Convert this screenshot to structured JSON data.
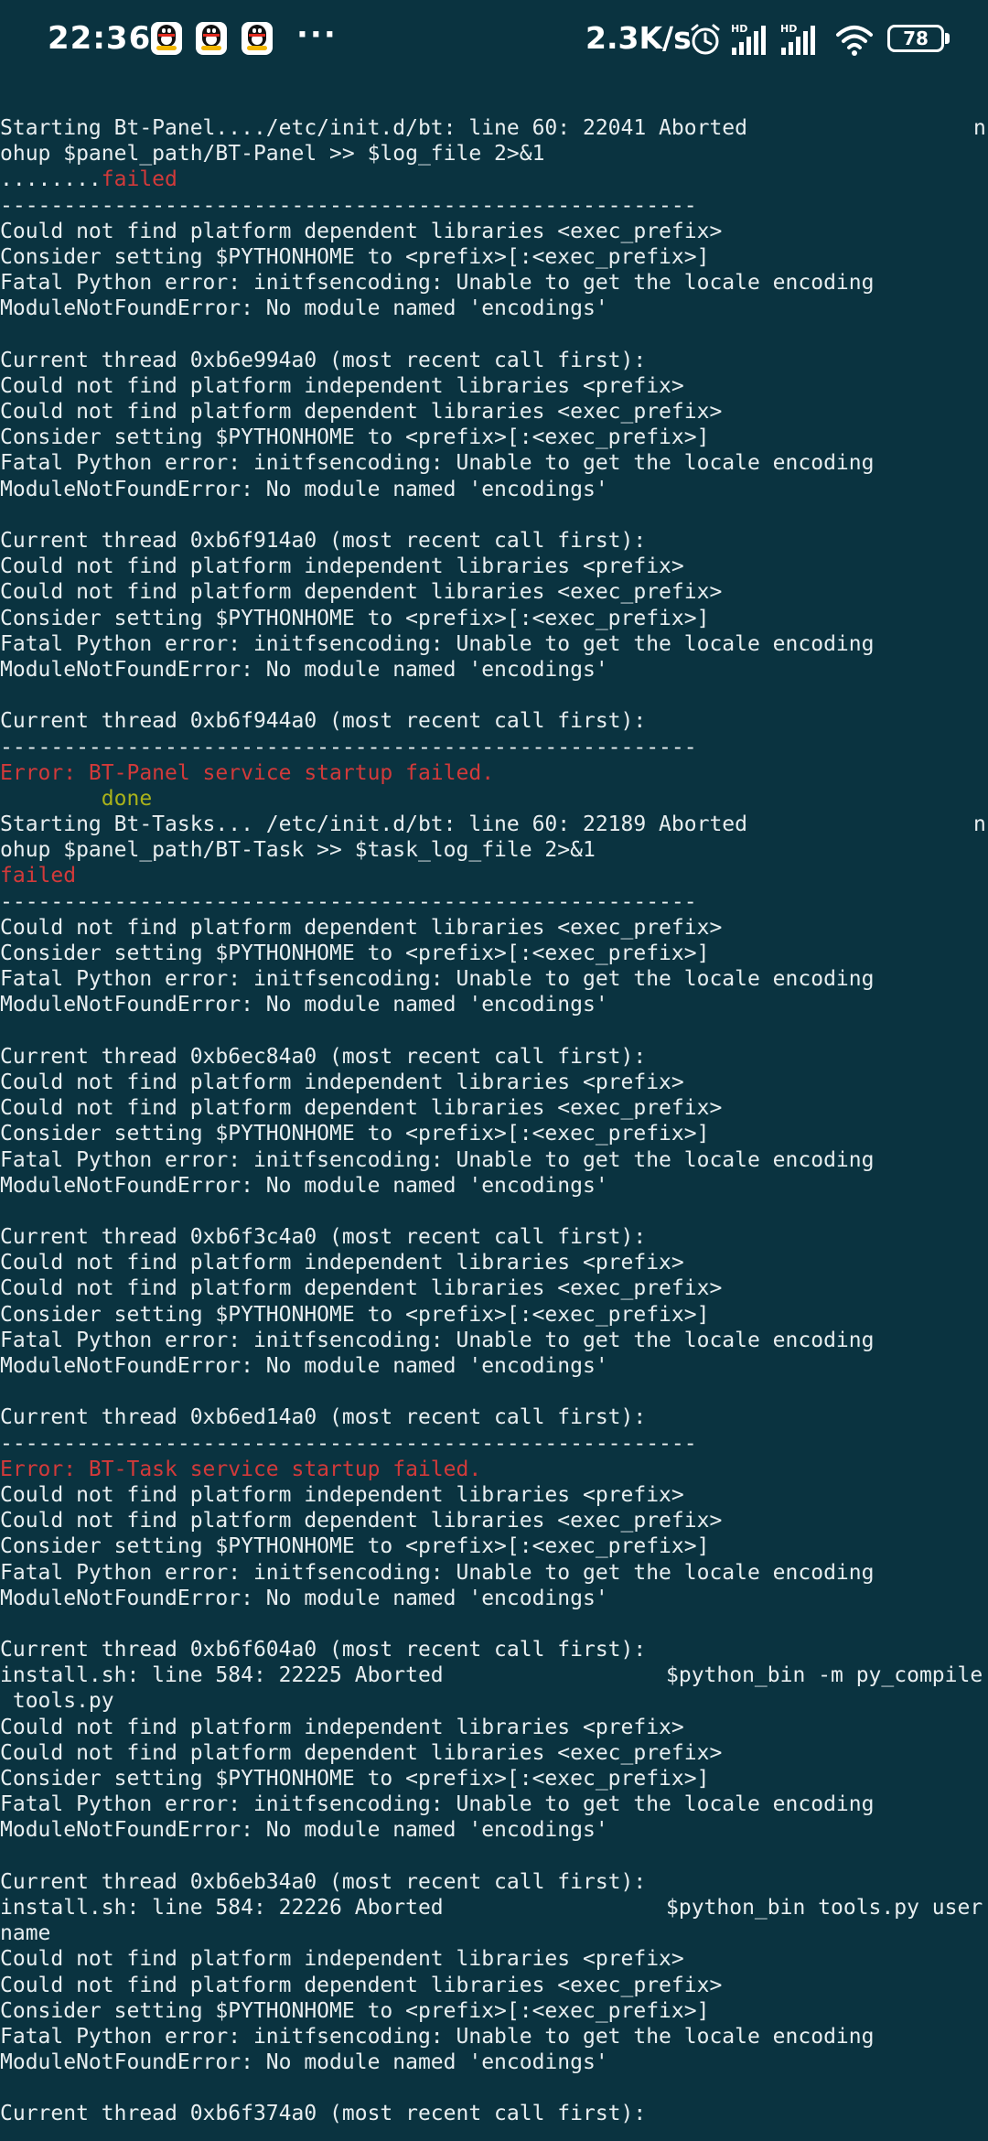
{
  "status_bar": {
    "time": "22:36",
    "more": "···",
    "network_speed": "2.3K/s",
    "battery_level": "78",
    "notification_icons": [
      "qq-icon",
      "qq-icon",
      "qq-icon"
    ],
    "right_icons": [
      "alarm-icon",
      "hd-signal-icon",
      "hd-signal-icon",
      "wifi-icon",
      "battery-icon"
    ],
    "hd_label": "HD"
  },
  "terminal": {
    "background": "#0a3340",
    "lines": [
      {
        "text": "Starting Bt-Panel..../etc/init.d/bt: line 60: 22041 Aborted",
        "right": "n"
      },
      {
        "text": "ohup $panel_path/BT-Panel >> $log_file 2>&1"
      },
      {
        "text": "........",
        "red_suffix": "failed"
      },
      {
        "text": "-------------------------------------------------------"
      },
      {
        "text": "Could not find platform dependent libraries <exec_prefix>"
      },
      {
        "text": "Consider setting $PYTHONHOME to <prefix>[:<exec_prefix>]"
      },
      {
        "text": "Fatal Python error: initfsencoding: Unable to get the locale encoding"
      },
      {
        "text": "ModuleNotFoundError: No module named 'encodings'"
      },
      {
        "text": ""
      },
      {
        "text": "Current thread 0xb6e994a0 (most recent call first):"
      },
      {
        "text": "Could not find platform independent libraries <prefix>"
      },
      {
        "text": "Could not find platform dependent libraries <exec_prefix>"
      },
      {
        "text": "Consider setting $PYTHONHOME to <prefix>[:<exec_prefix>]"
      },
      {
        "text": "Fatal Python error: initfsencoding: Unable to get the locale encoding"
      },
      {
        "text": "ModuleNotFoundError: No module named 'encodings'"
      },
      {
        "text": ""
      },
      {
        "text": "Current thread 0xb6f914a0 (most recent call first):"
      },
      {
        "text": "Could not find platform independent libraries <prefix>"
      },
      {
        "text": "Could not find platform dependent libraries <exec_prefix>"
      },
      {
        "text": "Consider setting $PYTHONHOME to <prefix>[:<exec_prefix>]"
      },
      {
        "text": "Fatal Python error: initfsencoding: Unable to get the locale encoding"
      },
      {
        "text": "ModuleNotFoundError: No module named 'encodings'"
      },
      {
        "text": ""
      },
      {
        "text": "Current thread 0xb6f944a0 (most recent call first):"
      },
      {
        "text": "-------------------------------------------------------"
      },
      {
        "text": "Error: BT-Panel service startup failed.",
        "color": "red"
      },
      {
        "text": "        done",
        "color": "yellow"
      },
      {
        "text": "Starting Bt-Tasks... /etc/init.d/bt: line 60: 22189 Aborted",
        "right": "n"
      },
      {
        "text": "ohup $panel_path/BT-Task >> $task_log_file 2>&1"
      },
      {
        "text": "failed",
        "color": "red"
      },
      {
        "text": "-------------------------------------------------------"
      },
      {
        "text": "Could not find platform dependent libraries <exec_prefix>"
      },
      {
        "text": "Consider setting $PYTHONHOME to <prefix>[:<exec_prefix>]"
      },
      {
        "text": "Fatal Python error: initfsencoding: Unable to get the locale encoding"
      },
      {
        "text": "ModuleNotFoundError: No module named 'encodings'"
      },
      {
        "text": ""
      },
      {
        "text": "Current thread 0xb6ec84a0 (most recent call first):"
      },
      {
        "text": "Could not find platform independent libraries <prefix>"
      },
      {
        "text": "Could not find platform dependent libraries <exec_prefix>"
      },
      {
        "text": "Consider setting $PYTHONHOME to <prefix>[:<exec_prefix>]"
      },
      {
        "text": "Fatal Python error: initfsencoding: Unable to get the locale encoding"
      },
      {
        "text": "ModuleNotFoundError: No module named 'encodings'"
      },
      {
        "text": ""
      },
      {
        "text": "Current thread 0xb6f3c4a0 (most recent call first):"
      },
      {
        "text": "Could not find platform independent libraries <prefix>"
      },
      {
        "text": "Could not find platform dependent libraries <exec_prefix>"
      },
      {
        "text": "Consider setting $PYTHONHOME to <prefix>[:<exec_prefix>]"
      },
      {
        "text": "Fatal Python error: initfsencoding: Unable to get the locale encoding"
      },
      {
        "text": "ModuleNotFoundError: No module named 'encodings'"
      },
      {
        "text": ""
      },
      {
        "text": "Current thread 0xb6ed14a0 (most recent call first):"
      },
      {
        "text": "-------------------------------------------------------"
      },
      {
        "text": "Error: BT-Task service startup failed.",
        "color": "red"
      },
      {
        "text": "Could not find platform independent libraries <prefix>"
      },
      {
        "text": "Could not find platform dependent libraries <exec_prefix>"
      },
      {
        "text": "Consider setting $PYTHONHOME to <prefix>[:<exec_prefix>]"
      },
      {
        "text": "Fatal Python error: initfsencoding: Unable to get the locale encoding"
      },
      {
        "text": "ModuleNotFoundError: No module named 'encodings'"
      },
      {
        "text": ""
      },
      {
        "text": "Current thread 0xb6f604a0 (most recent call first):"
      },
      {
        "text": "install.sh: line 584: 22225 Aborted",
        "right_cmd": "$python_bin -m py_compile"
      },
      {
        "text": " tools.py"
      },
      {
        "text": "Could not find platform independent libraries <prefix>"
      },
      {
        "text": "Could not find platform dependent libraries <exec_prefix>"
      },
      {
        "text": "Consider setting $PYTHONHOME to <prefix>[:<exec_prefix>]"
      },
      {
        "text": "Fatal Python error: initfsencoding: Unable to get the locale encoding"
      },
      {
        "text": "ModuleNotFoundError: No module named 'encodings'"
      },
      {
        "text": ""
      },
      {
        "text": "Current thread 0xb6eb34a0 (most recent call first):"
      },
      {
        "text": "install.sh: line 584: 22226 Aborted",
        "right_cmd": "$python_bin tools.py user"
      },
      {
        "text": "name"
      },
      {
        "text": "Could not find platform independent libraries <prefix>"
      },
      {
        "text": "Could not find platform dependent libraries <exec_prefix>"
      },
      {
        "text": "Consider setting $PYTHONHOME to <prefix>[:<exec_prefix>]"
      },
      {
        "text": "Fatal Python error: initfsencoding: Unable to get the locale encoding"
      },
      {
        "text": "ModuleNotFoundError: No module named 'encodings'"
      },
      {
        "text": ""
      },
      {
        "text": "Current thread 0xb6f374a0 (most recent call first):"
      }
    ]
  }
}
